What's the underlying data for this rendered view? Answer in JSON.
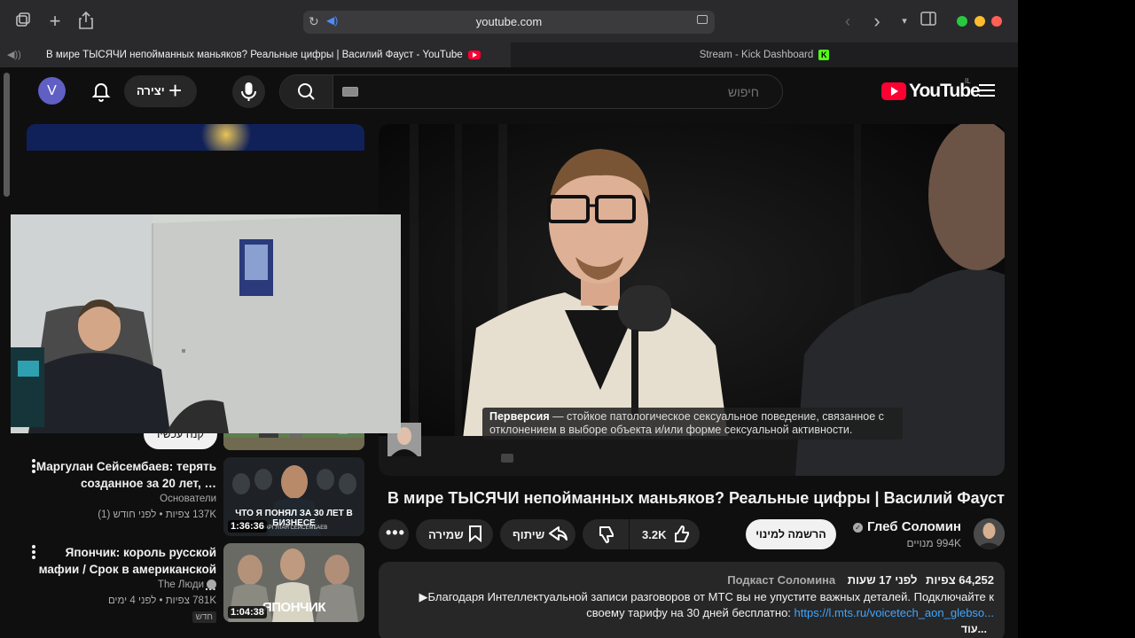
{
  "browser": {
    "url": "youtube.com",
    "tabs": [
      {
        "title": "В мире ТЫСЯЧИ непойманных маньяков? Реальные цифры | Василий Фауст - YouTube"
      },
      {
        "title": "Stream - Kick Dashboard"
      }
    ],
    "traffic_colors": [
      "#28c840",
      "#febc2e",
      "#ff5f57"
    ]
  },
  "masthead": {
    "avatar_letter": "V",
    "create_label": "יצירה",
    "search_placeholder": "חיפוש",
    "logo_text": "YouTube",
    "country_code": "IL"
  },
  "player": {
    "subtitle_term": "Перверсия",
    "subtitle_text": " — стойкое патологическое сексуальное поведение, связанное с отклонением в выборе объекта и/или форме сексуальной активности."
  },
  "video": {
    "title": "В мире ТЫСЯЧИ непойманных маньяков? Реальные цифры | Василий Фауст",
    "save_label": "שמירה",
    "share_label": "שיתוף",
    "likes": "3.2K",
    "subscribe_label": "הרשמה למינוי",
    "channel_name": "Глеб Соломин",
    "channel_subs": "994K מנויים"
  },
  "description": {
    "views": "64,252 צפיות",
    "ago": "לפני 17 שעות",
    "tag": "Подкаст Соломина",
    "line1": "▶Благодаря Интеллектуальной записи разговоров от МТС вы не упустите важных деталей. Подключайте к",
    "line2_text": "своему тарифу на 30 дней бесплатно: ",
    "line2_link": "https://l.mts.ru/voicetech_aon_glebso...",
    "more": "...עוד"
  },
  "ad": {
    "buy_label": "קנה עכשיו"
  },
  "recommendations": [
    {
      "title": "Маргулан Сейсембаев: терять созданное за 20 лет, …",
      "channel": "Основатели",
      "meta": "137K צפיות • לפני חודש (1)",
      "duration": "1:36:36",
      "thumb_caption": "ЧТО Я ПОНЯЛ ЗА 30 ЛЕТ В БИЗНЕСЕ",
      "thumb_caption2": "МАРГУЛАН СЕЙСЕМБАЕВ",
      "verified": false,
      "badge": ""
    },
    {
      "title": "Япончик: король русской мафии / Срок в американской …",
      "channel": "The Люди",
      "meta": "781K צפיות • לפני 4 ימים",
      "duration": "1:04:38",
      "thumb_caption": "ЯПОНЧИК",
      "thumb_caption2": "",
      "verified": true,
      "badge": "חדש"
    }
  ]
}
